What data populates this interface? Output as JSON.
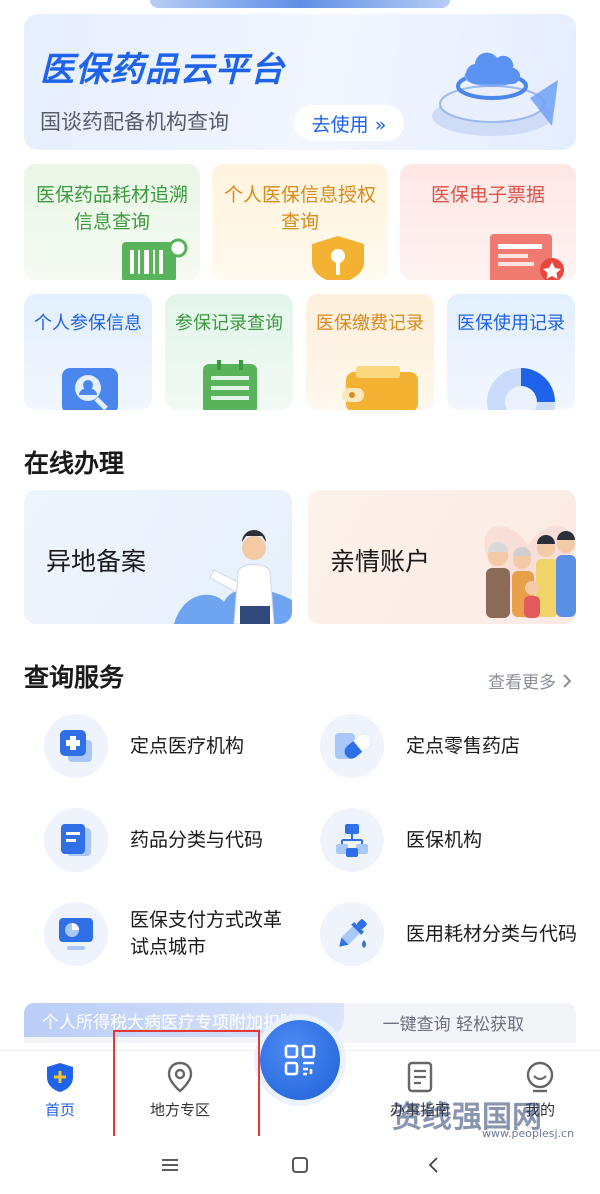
{
  "banner": {
    "title": "医保药品云平台",
    "subtitle": "国谈药配备机构查询",
    "button": "去使用 »"
  },
  "grid_row1": [
    {
      "label": "医保药品耗材追溯信息查询",
      "color": "#3c9a3e",
      "bg": "#e8f6e5"
    },
    {
      "label": "个人医保信息授权查询",
      "color": "#d88a1a",
      "bg": "#fdf3de"
    },
    {
      "label": "医保电子票据",
      "color": "#e0524c",
      "bg": "#fde8e6"
    }
  ],
  "grid_row2": [
    {
      "label": "个人参保信息",
      "color": "#1e63e9",
      "bg": "#e6f0fd"
    },
    {
      "label": "参保记录查询",
      "color": "#3c9a3e",
      "bg": "#e6f6ec"
    },
    {
      "label": "医保缴费记录",
      "color": "#d88a1a",
      "bg": "#fdf1e1"
    },
    {
      "label": "医保使用记录",
      "color": "#1e63e9",
      "bg": "#e6f0fd"
    }
  ],
  "online": {
    "title": "在线办理",
    "items": [
      "异地备案",
      "亲情账户"
    ]
  },
  "query": {
    "title": "查询服务",
    "more": "查看更多",
    "items": [
      {
        "label": "定点医疗机构",
        "icon": "medical-cross-icon"
      },
      {
        "label": "定点零售药店",
        "icon": "pill-icon"
      },
      {
        "label": "药品分类与代码",
        "icon": "document-icon"
      },
      {
        "label": "医保机构",
        "icon": "organization-icon"
      },
      {
        "label": "医保支付方式改革试点城市",
        "icon": "monitor-chart-icon"
      },
      {
        "label": "医用耗材分类与代码",
        "icon": "dropper-icon"
      }
    ]
  },
  "promo": {
    "tag": "个人所得税大病医疗专项附加扣除",
    "text": "一键查询 轻松获取"
  },
  "tabbar": {
    "home": "首页",
    "local": "地方专区",
    "guide": "办事指南",
    "mine": "我的"
  },
  "watermark": {
    "text": "资线强国网",
    "url": "www.peoplesj.cn"
  },
  "colors": {
    "accent": "#1e63e9",
    "highlight": "#e53935"
  }
}
